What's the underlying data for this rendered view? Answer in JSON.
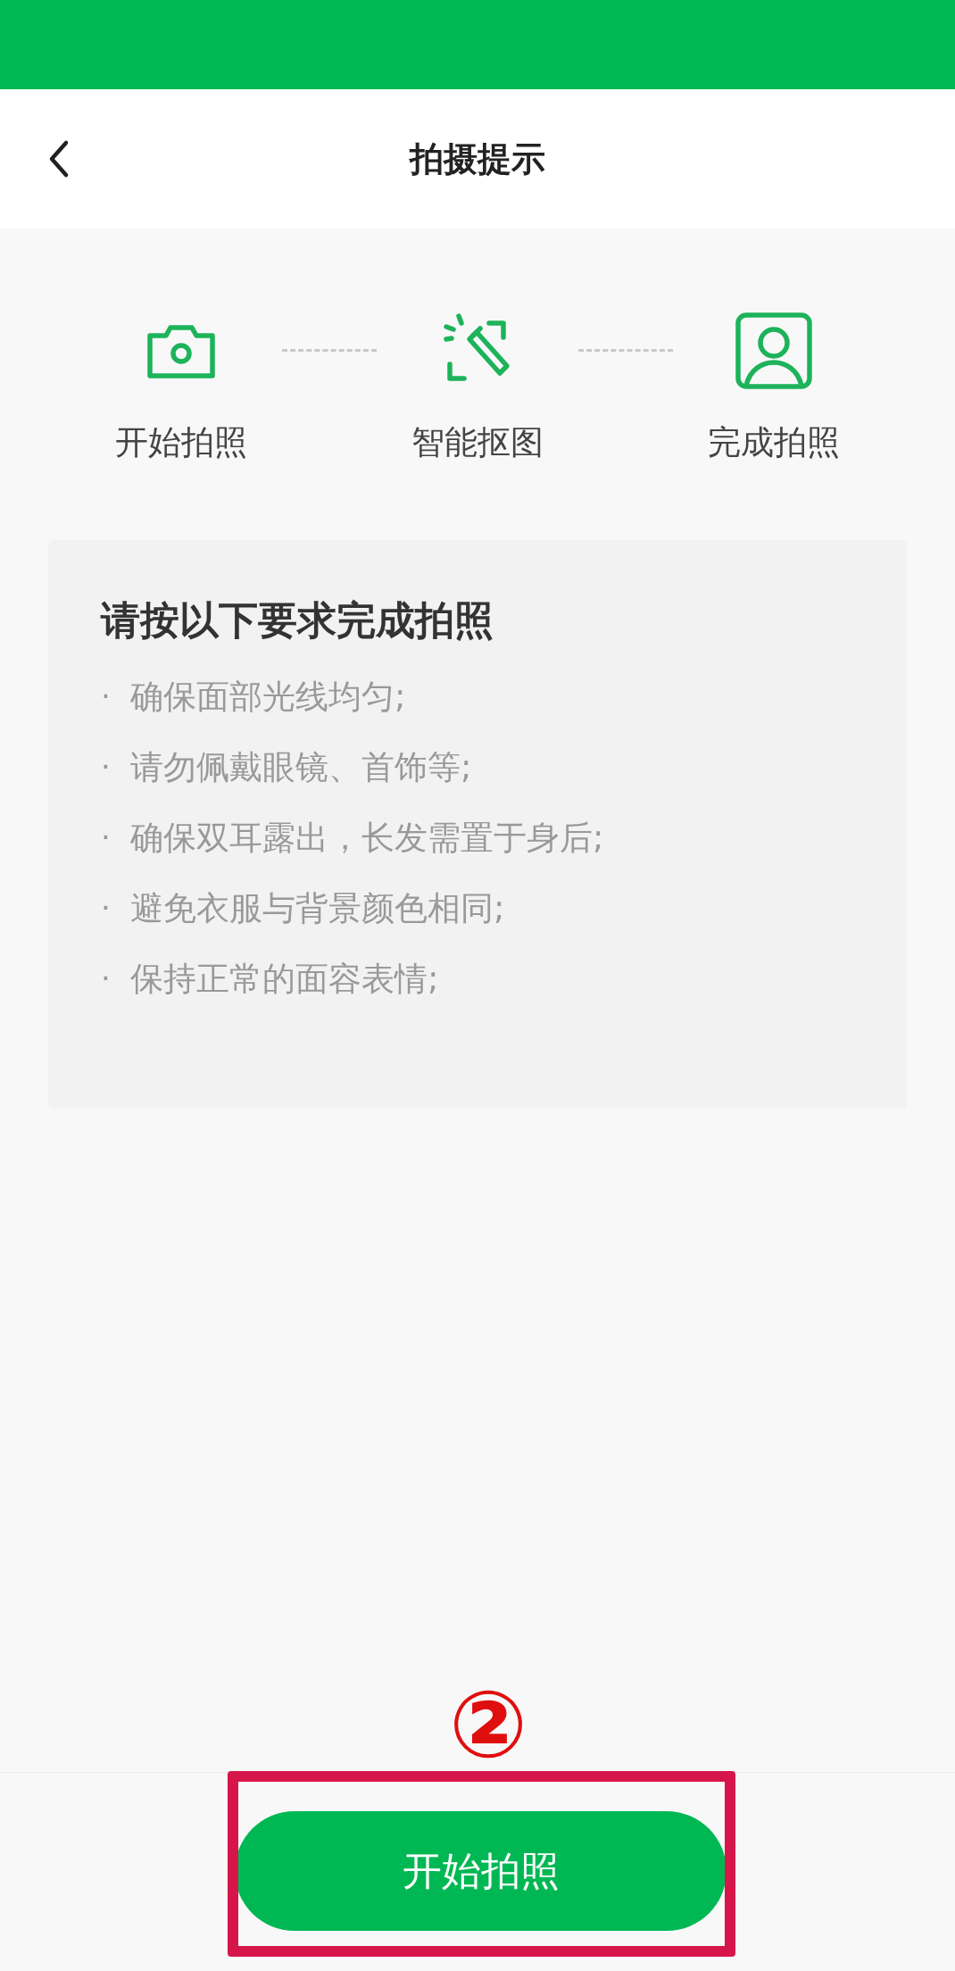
{
  "header": {
    "title": "拍摄提示"
  },
  "steps": [
    {
      "kind": "camera",
      "label": "开始拍照"
    },
    {
      "kind": "cutout",
      "label": "智能抠图"
    },
    {
      "kind": "portrait",
      "label": "完成拍照"
    }
  ],
  "requirements": {
    "title": "请按以下要求完成拍照",
    "items": [
      {
        "bullet": "·",
        "text": "确保面部光线均匀;"
      },
      {
        "bullet": "·",
        "text": "请勿佩戴眼镜、首饰等;"
      },
      {
        "bullet": "·",
        "text": "确保双耳露出，长发需置于身后;"
      },
      {
        "bullet": "·",
        "text": "避免衣服与背景颜色相同;"
      },
      {
        "bullet": "·",
        "text": "保持正常的面容表情;"
      }
    ]
  },
  "annotation_number": "②",
  "primary_button": "开始拍照"
}
